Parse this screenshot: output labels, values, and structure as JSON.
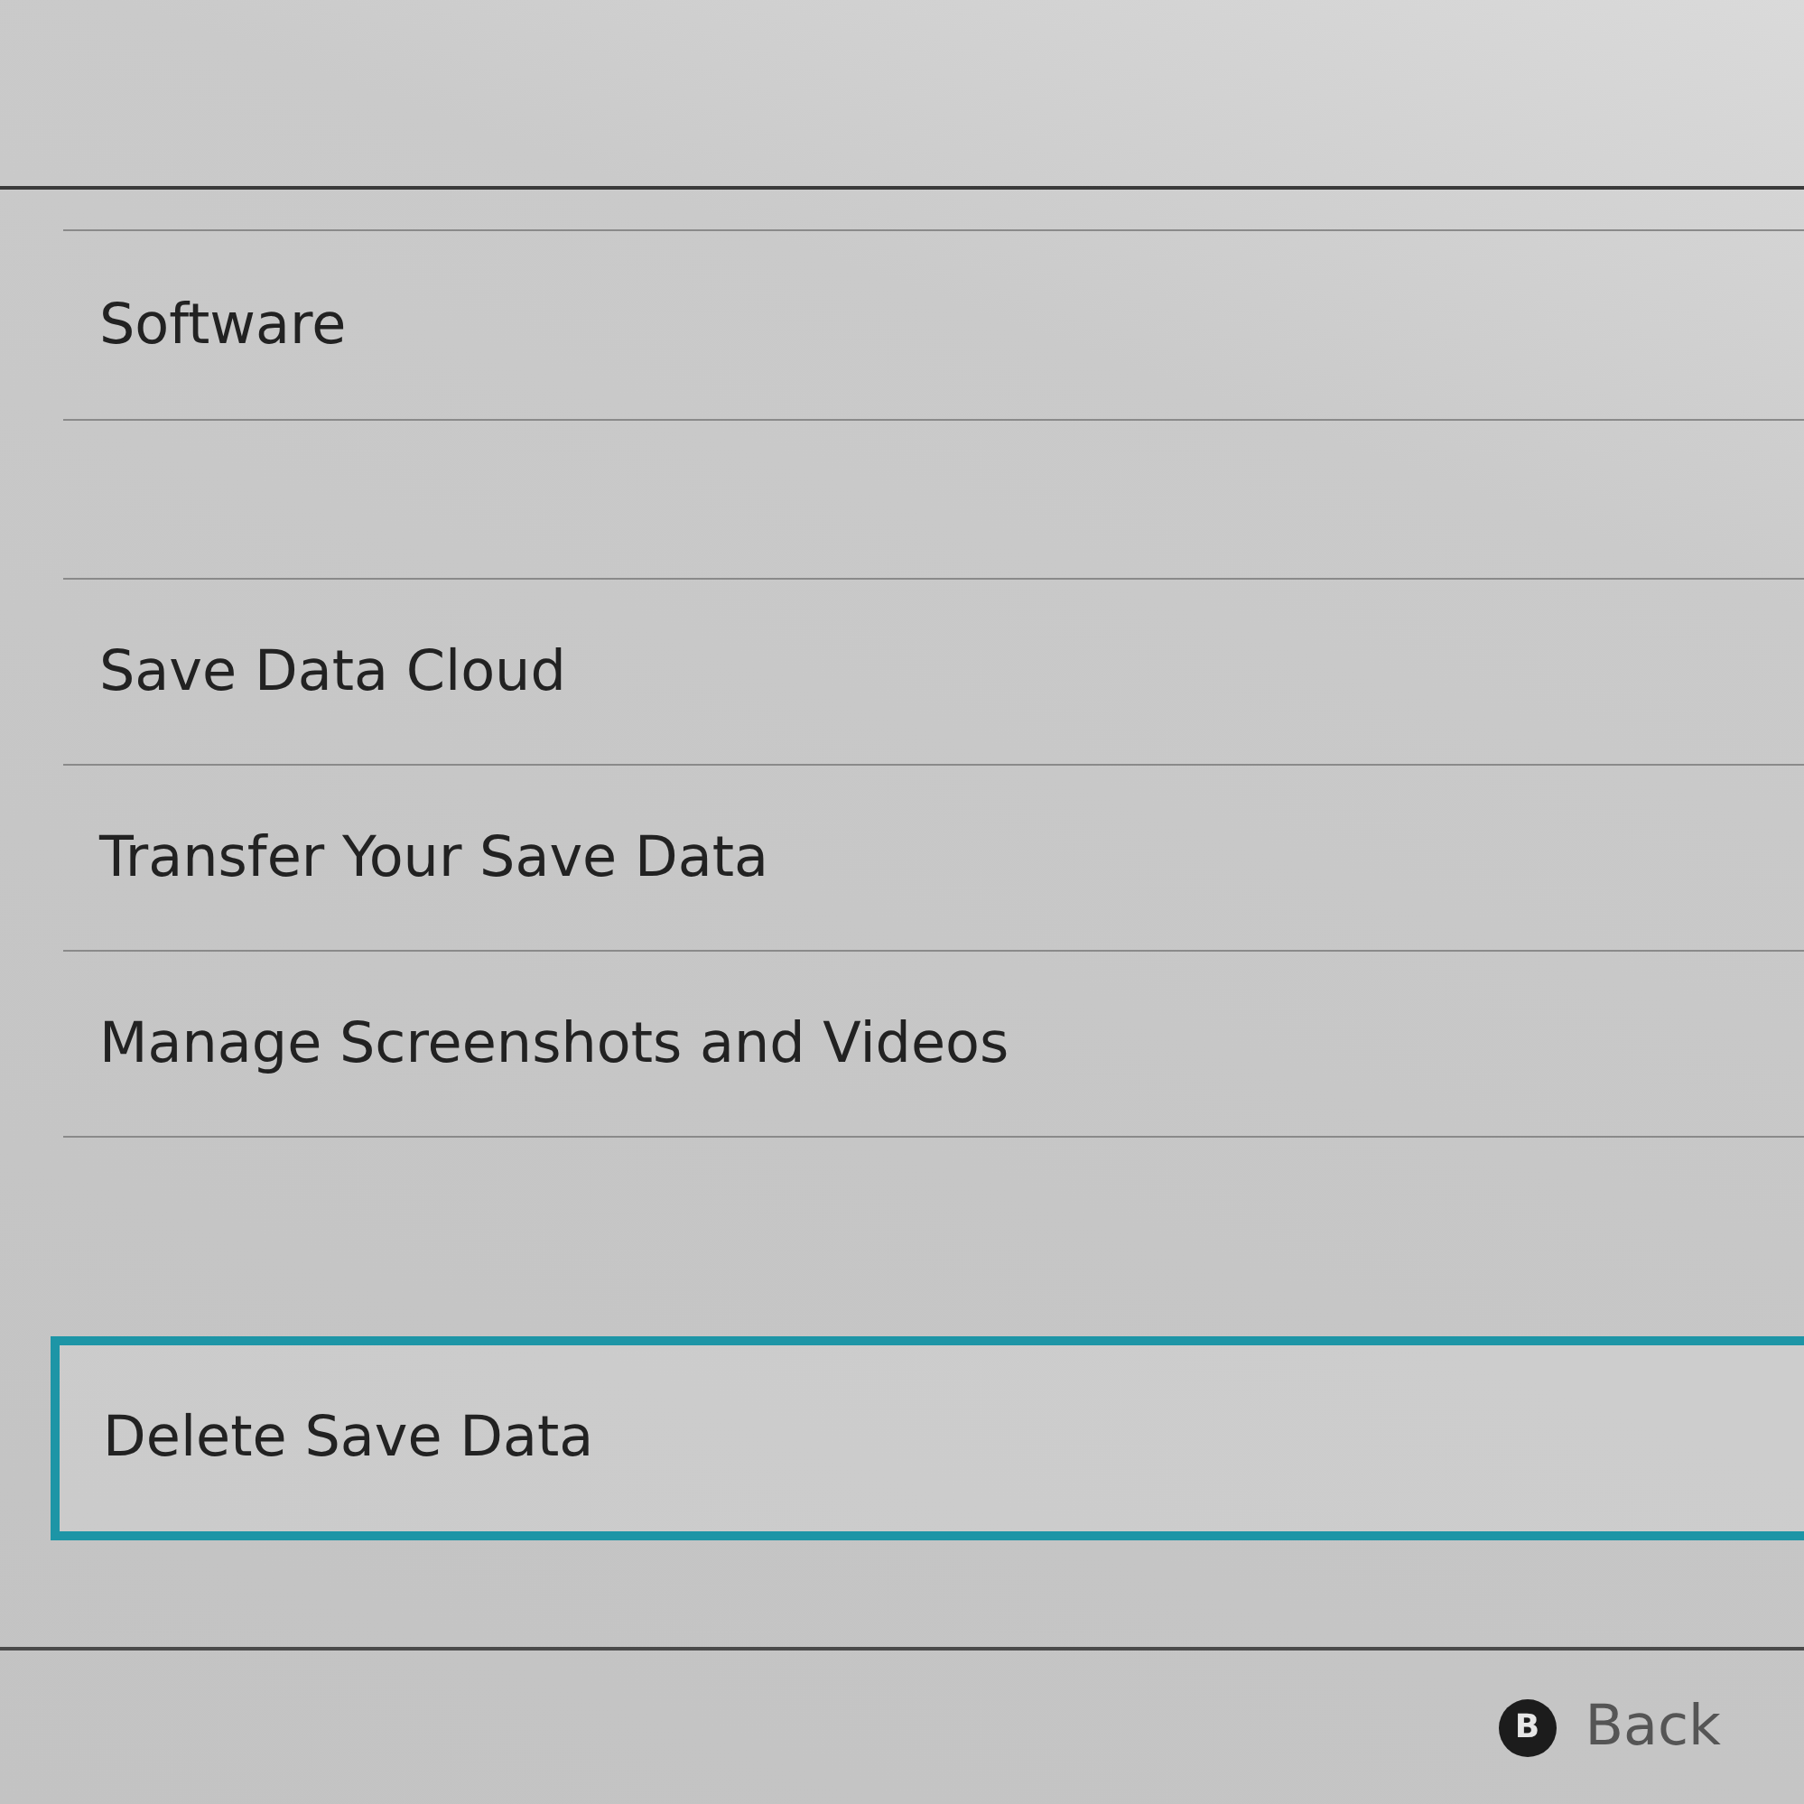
{
  "menu_groups": [
    {
      "items": [
        {
          "label": "Software",
          "selected": false
        }
      ]
    },
    {
      "items": [
        {
          "label": "Save Data Cloud",
          "selected": false
        },
        {
          "label": "Transfer Your Save Data",
          "selected": false
        },
        {
          "label": "Manage Screenshots and Videos",
          "selected": false
        }
      ]
    },
    {
      "items": [
        {
          "label": "Delete Save Data",
          "selected": true
        }
      ]
    }
  ],
  "footer": {
    "key": "B",
    "label": "Back"
  }
}
